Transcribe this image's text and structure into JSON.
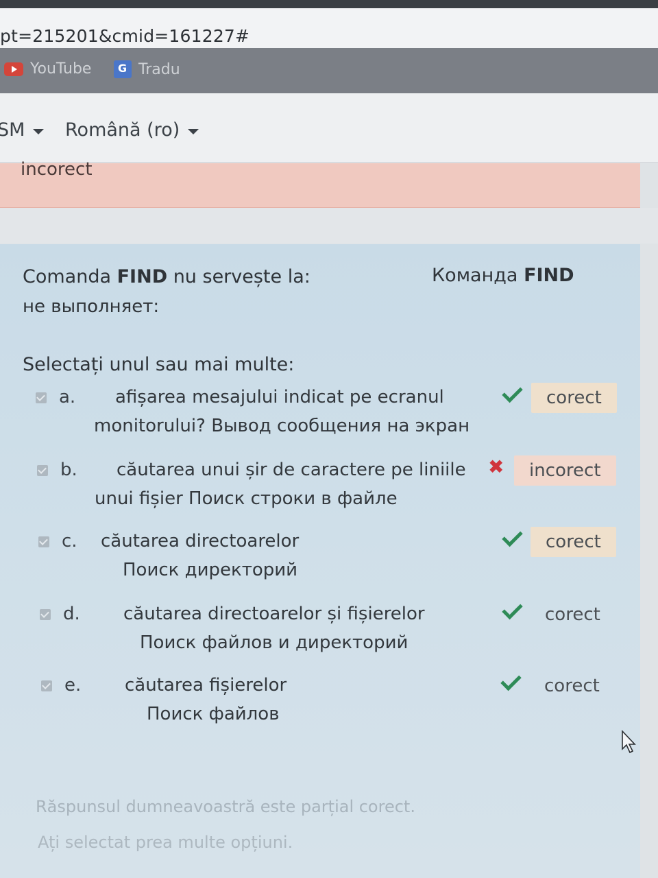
{
  "browser": {
    "url_fragment": "pt=215201&cmid=161227#",
    "bookmarks": [
      {
        "label": "YouTube",
        "icon": "youtube-icon"
      },
      {
        "label": "Tradu",
        "icon": "translate-icon"
      }
    ]
  },
  "nav": {
    "left_item": "SM",
    "language": "Română (ro)"
  },
  "previous_feedback": "incorect",
  "question": {
    "text_ro_prefix": "Comanda ",
    "text_ro_bold": "FIND",
    "text_ro_suffix": " nu servește la:",
    "text_ru_prefix": "Команда ",
    "text_ru_bold": "FIND",
    "text_ru_line2": "не выполняет:",
    "prompt": "Selectați unul sau mai multe:"
  },
  "options": [
    {
      "letter": "a.",
      "line1": "afișarea mesajului indicat pe ecranul",
      "line2": "monitorului?    Вывод сообщения на экран",
      "result": "corect",
      "status": "correct"
    },
    {
      "letter": "b.",
      "line1": "căutarea unui șir de caractere pe liniile",
      "line2": "unui fișier           Поиск строки в файле",
      "result": "incorect",
      "status": "incorrect"
    },
    {
      "letter": "c.",
      "line1": "căutarea directoarelor",
      "line2": "Поиск директорий",
      "result": "corect",
      "status": "correct"
    },
    {
      "letter": "d.",
      "line1": "căutarea directoarelor și fișierelor",
      "line2": "Поиск файлов и директорий",
      "result": "corect",
      "status": "correct"
    },
    {
      "letter": "e.",
      "line1": "căutarea fișierelor",
      "line2": "Поиск файлов",
      "result": "corect",
      "status": "correct"
    }
  ],
  "summary": {
    "line1": "Răspunsul dumneavoastră este parțial corect.",
    "line2": "Ați selectat prea multe opțiuni."
  },
  "colors": {
    "panel": "#cfdfe9",
    "feedback_bg": "#f0c9c0",
    "check": "#2e8b57",
    "cross": "#d0343c"
  }
}
